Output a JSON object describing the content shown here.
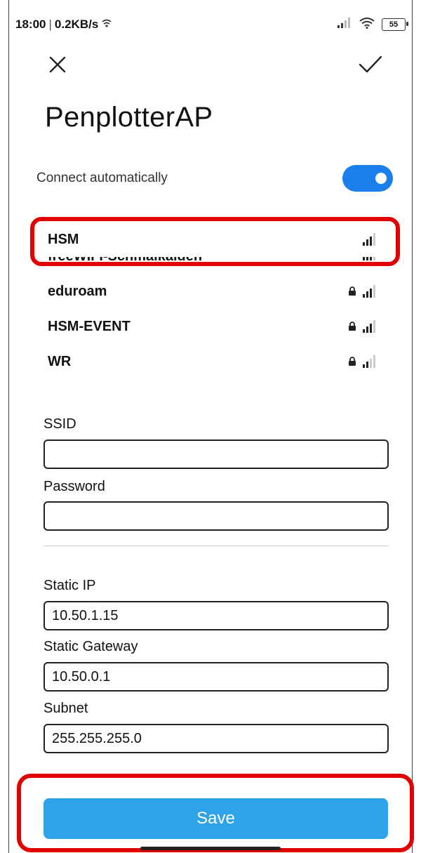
{
  "status_bar": {
    "time": "18:00",
    "separator": "|",
    "network_speed": "0.2KB/s",
    "battery": "55",
    "icons": [
      "hotspot-icon",
      "signal-icon",
      "wifi-icon",
      "battery-icon"
    ]
  },
  "toolbar": {
    "close_icon": "close-icon",
    "confirm_icon": "check-icon"
  },
  "title": "PenplotterAP",
  "auto_connect": {
    "label": "Connect automatically",
    "enabled": true
  },
  "networks": [
    {
      "name": "HSM",
      "locked": false,
      "signal_bars": 3
    },
    {
      "name": "freeWIFI-Schmalkalden",
      "locked": false,
      "signal_bars": 3
    },
    {
      "name": "eduroam",
      "locked": true,
      "signal_bars": 3
    },
    {
      "name": "HSM-EVENT",
      "locked": true,
      "signal_bars": 3
    },
    {
      "name": "WR",
      "locked": true,
      "signal_bars": 2
    }
  ],
  "form": {
    "ssid": {
      "label": "SSID",
      "value": ""
    },
    "password": {
      "label": "Password",
      "value": ""
    },
    "static_ip": {
      "label": "Static IP",
      "value": "10.50.1.15"
    },
    "static_gateway": {
      "label": "Static Gateway",
      "value": "10.50.0.1"
    },
    "subnet": {
      "label": "Subnet",
      "value": "255.255.255.0"
    }
  },
  "save_label": "Save",
  "colors": {
    "accent": "#1a7fea",
    "save_button": "#2fa3ea",
    "highlight": "#e00000"
  }
}
